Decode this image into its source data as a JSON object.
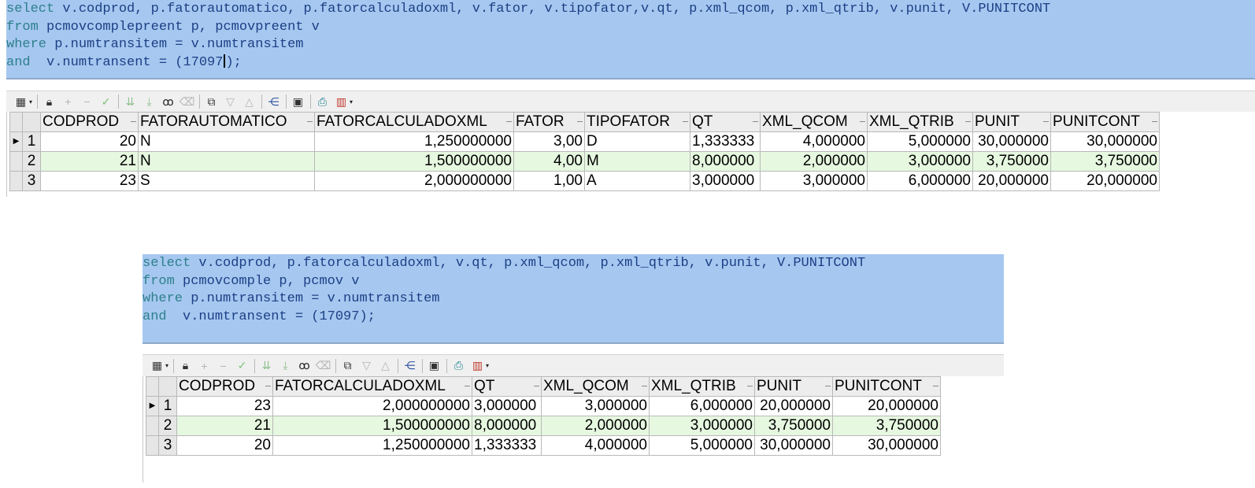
{
  "query1": {
    "lines": [
      [
        {
          "t": "select",
          "k": true
        },
        {
          "t": " v.codprod, p.fatorautomatico, p.fatorcalculadoxml, v.fator, v.tipofator,v.qt, p.xml_qcom, p.xml_qtrib, v.punit, V.PUNITCONT",
          "k": false
        }
      ],
      [
        {
          "t": "from",
          "k": true
        },
        {
          "t": " pcmovcomplepreent p, pcmovpreent v",
          "k": false
        }
      ],
      [
        {
          "t": "where",
          "k": true
        },
        {
          "t": " p.numtransitem = v.numtransitem",
          "k": false
        }
      ],
      [
        {
          "t": "and",
          "k": true
        },
        {
          "t": "  v.numtransent = (17097",
          "k": false
        },
        {
          "t": "CARET",
          "k": false
        },
        {
          "t": ");",
          "k": false
        }
      ]
    ]
  },
  "grid1": {
    "columns": [
      "CODPROD",
      "FATORAUTOMATICO",
      "FATORCALCULADOXML",
      "FATOR",
      "TIPOFATOR",
      "QT",
      "XML_QCOM",
      "XML_QTRIB",
      "PUNIT",
      "PUNITCONT"
    ],
    "align": [
      "r",
      "l",
      "r",
      "r",
      "l",
      "l",
      "r",
      "r",
      "r",
      "r"
    ],
    "rows": [
      [
        "1",
        "20",
        "N",
        "1,250000000",
        "3,00",
        "D",
        "1,333333",
        "4,000000",
        "5,000000",
        "30,000000",
        "30,000000"
      ],
      [
        "2",
        "21",
        "N",
        "1,500000000",
        "4,00",
        "M",
        "8,000000",
        "2,000000",
        "3,000000",
        "3,750000",
        "3,750000"
      ],
      [
        "3",
        "23",
        "S",
        "2,000000000",
        "1,00",
        "A",
        "3,000000",
        "3,000000",
        "6,000000",
        "20,000000",
        "20,000000"
      ]
    ],
    "current_row_marker": "▶"
  },
  "query2": {
    "lines": [
      [
        {
          "t": "select",
          "k": true
        },
        {
          "t": " v.codprod, p.fatorcalculadoxml, v.qt, p.xml_qcom, p.xml_qtrib, v.punit, V.PUNITCONT",
          "k": false
        }
      ],
      [
        {
          "t": "from",
          "k": true
        },
        {
          "t": " pcmovcomple p, pcmov v",
          "k": false
        }
      ],
      [
        {
          "t": "where",
          "k": true
        },
        {
          "t": " p.numtransitem = v.numtransitem",
          "k": false
        }
      ],
      [
        {
          "t": "and",
          "k": true
        },
        {
          "t": "  v.numtransent = (17097);",
          "k": false
        }
      ]
    ]
  },
  "grid2": {
    "columns": [
      "CODPROD",
      "FATORCALCULADOXML",
      "QT",
      "XML_QCOM",
      "XML_QTRIB",
      "PUNIT",
      "PUNITCONT"
    ],
    "align": [
      "r",
      "r",
      "l",
      "r",
      "r",
      "r",
      "r"
    ],
    "rows": [
      [
        "1",
        "23",
        "2,000000000",
        "3,000000",
        "3,000000",
        "6,000000",
        "20,000000",
        "20,000000"
      ],
      [
        "2",
        "21",
        "1,500000000",
        "8,000000",
        "2,000000",
        "3,000000",
        "3,750000",
        "3,750000"
      ],
      [
        "3",
        "20",
        "1,250000000",
        "1,333333",
        "4,000000",
        "5,000000",
        "30,000000",
        "30,000000"
      ]
    ],
    "current_row_marker": "▶"
  },
  "toolbar": {
    "icons": [
      "grid-view-icon",
      "dropdown-arrow-icon",
      "lock-icon",
      "add-record-icon",
      "delete-record-icon",
      "post-record-icon",
      "fetch-next-page-icon",
      "fetch-last-page-icon",
      "find-binoculars-icon",
      "clear-record-icon",
      "query-by-example-icon",
      "filter-down-icon",
      "filter-up-icon",
      "export-tree-icon",
      "save-icon",
      "print-icon",
      "chart-icon",
      "chart-dropdown-icon"
    ]
  },
  "colors": {
    "editor_bg": "#a6c8f0",
    "keyword": "#2e7f8c",
    "identifier": "#1c3f86",
    "alt_row": "#e6f8e0",
    "header_bg": "#ededed"
  }
}
